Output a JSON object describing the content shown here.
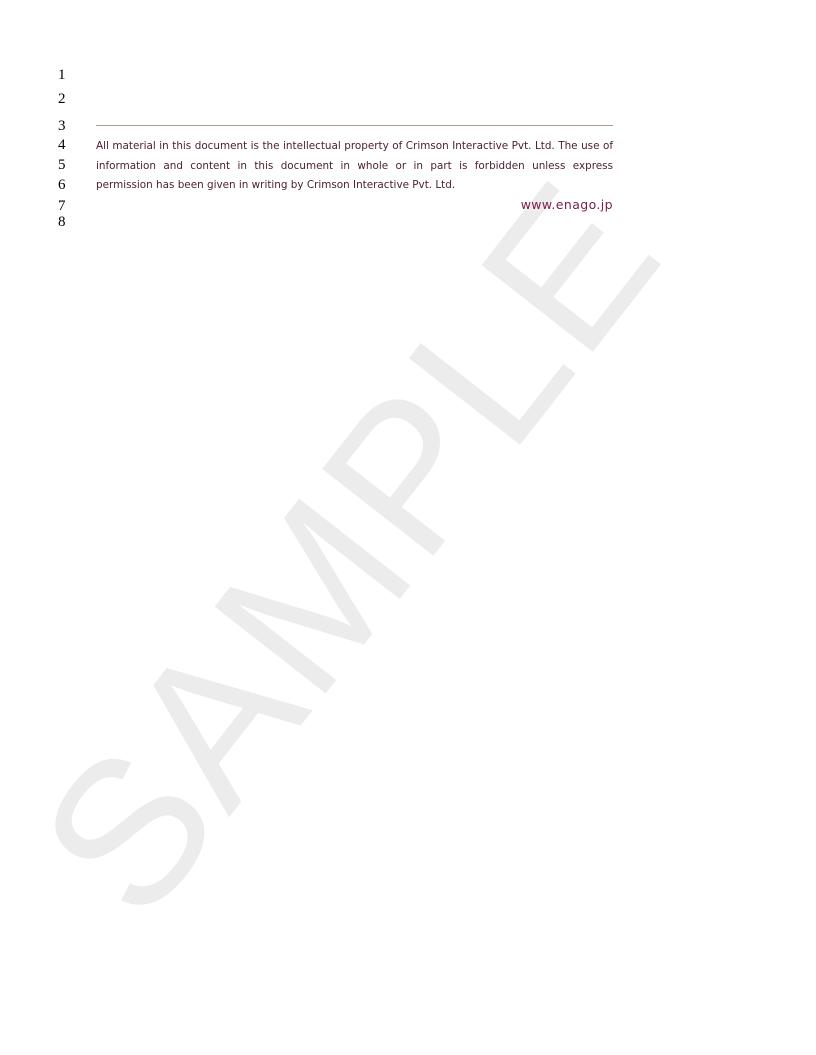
{
  "line_numbers": [
    "1",
    "2",
    "3",
    "4",
    "5",
    "6",
    "7",
    "8"
  ],
  "notice": {
    "text": "All material in this document is the intellectual property of Crimson Interactive Pvt. Ltd.  The use of information and content in this document in whole or in part is forbidden unless express permission has been given in writing by Crimson Interactive Pvt. Ltd."
  },
  "website": "www.enago.jp",
  "watermark": "SAMPLE",
  "colors": {
    "notice_text": "#4a1c32",
    "url_text": "#7a1e4a",
    "rule": "#b89a86",
    "watermark": "#ececec"
  }
}
